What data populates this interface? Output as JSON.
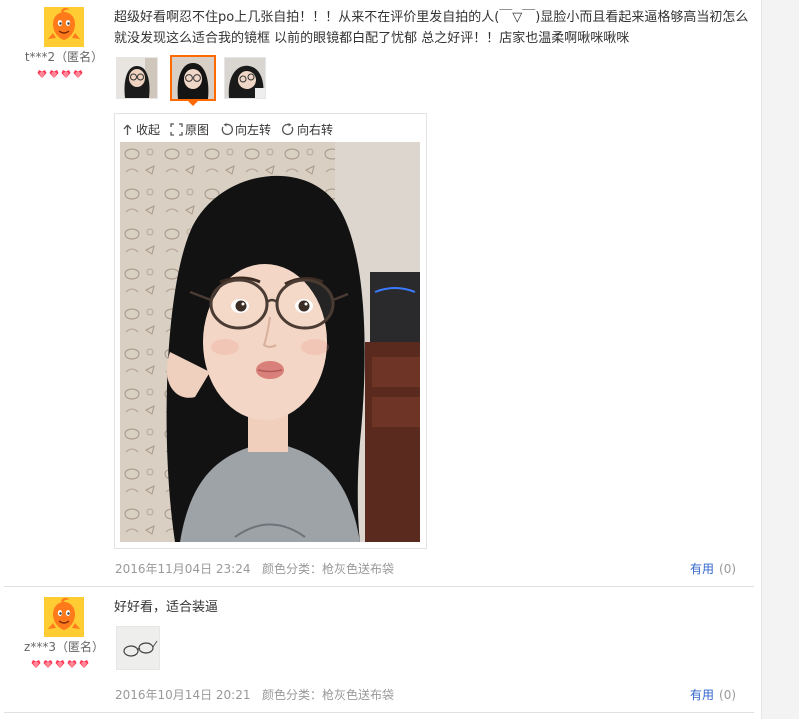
{
  "colors": {
    "accent": "#ff6a00",
    "link": "#3366cc",
    "muted": "#999999",
    "heart": "#ff3355"
  },
  "viewer_toolbar": {
    "collapse": "收起",
    "original": "原图",
    "rotate_left": "向左转",
    "rotate_right": "向右转"
  },
  "reviews": [
    {
      "user": "t***2（匿名）",
      "level_icon": "heart-gem",
      "level_count": 4,
      "text": "超级好看啊忍不住po上几张自拍！！！从来不在评价里发自拍的人(￣▽￣)显脸小而且看起来逼格够高当初怎么就没发现这么适合我的镜框 以前的眼镜都白配了忧郁 总之好评！！店家也温柔啊啾咪啾咪",
      "date": "2016年11月04日 23:24",
      "sku": "颜色分类：枪灰色送布袋",
      "useful_label": "有用",
      "useful_count": "(0)",
      "thumbnail_count": 3,
      "active_thumbnail": 2
    },
    {
      "user": "z***3（匿名）",
      "level_icon": "heart-gem",
      "level_count": 5,
      "text": "好好看，适合装逼",
      "date": "2016年10月14日 20:21",
      "sku": "颜色分类：枪灰色送布袋",
      "useful_label": "有用",
      "useful_count": "(0)",
      "thumbnail_count": 1
    }
  ]
}
